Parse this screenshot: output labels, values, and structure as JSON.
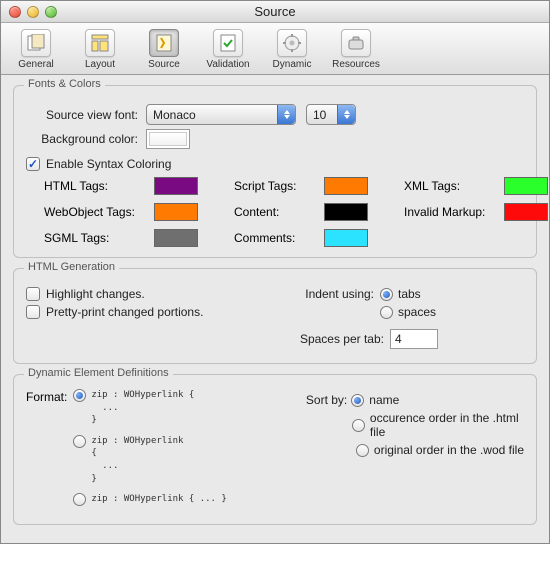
{
  "window": {
    "title": "Source"
  },
  "toolbar": {
    "items": [
      {
        "label": "General"
      },
      {
        "label": "Layout"
      },
      {
        "label": "Source",
        "selected": true
      },
      {
        "label": "Validation"
      },
      {
        "label": "Dynamic"
      },
      {
        "label": "Resources"
      }
    ]
  },
  "fontsColors": {
    "legend": "Fonts & Colors",
    "sourceFontLabel": "Source view font:",
    "fontName": "Monaco",
    "fontSize": "10",
    "bgLabel": "Background color:",
    "syntaxLabel": "Enable Syntax Coloring",
    "syntaxChecked": true,
    "tags": {
      "html": {
        "label": "HTML Tags:",
        "color": "#7a0a82"
      },
      "webobject": {
        "label": "WebObject Tags:",
        "color": "#ff7a00"
      },
      "sgml": {
        "label": "SGML Tags:",
        "color": "#6f6f6f"
      },
      "script": {
        "label": "Script Tags:",
        "color": "#ff7a00"
      },
      "content": {
        "label": "Content:",
        "color": "#000000"
      },
      "comments": {
        "label": "Comments:",
        "color": "#2be3ff"
      },
      "xml": {
        "label": "XML Tags:",
        "color": "#2bff2b"
      },
      "invalid": {
        "label": "Invalid Markup:",
        "color": "#ff0a0a"
      }
    }
  },
  "generation": {
    "legend": "HTML Generation",
    "highlight": "Highlight changes.",
    "pretty": "Pretty-print changed portions.",
    "indentLabel": "Indent using:",
    "indentTabs": "tabs",
    "indentSpaces": "spaces",
    "spacesPerTabLabel": "Spaces per tab:",
    "spacesPerTab": "4"
  },
  "ded": {
    "legend": "Dynamic Element Definitions",
    "formatLabel": "Format:",
    "fmt1": "zip : WOHyperlink {\n  ...\n}",
    "fmt2": "zip : WOHyperlink\n{\n  ...\n}",
    "fmt3": "zip : WOHyperlink { ... }",
    "sortLabel": "Sort by:",
    "sortName": "name",
    "sortHtml": "occurence order in the .html file",
    "sortWod": "original order in the .wod file"
  }
}
